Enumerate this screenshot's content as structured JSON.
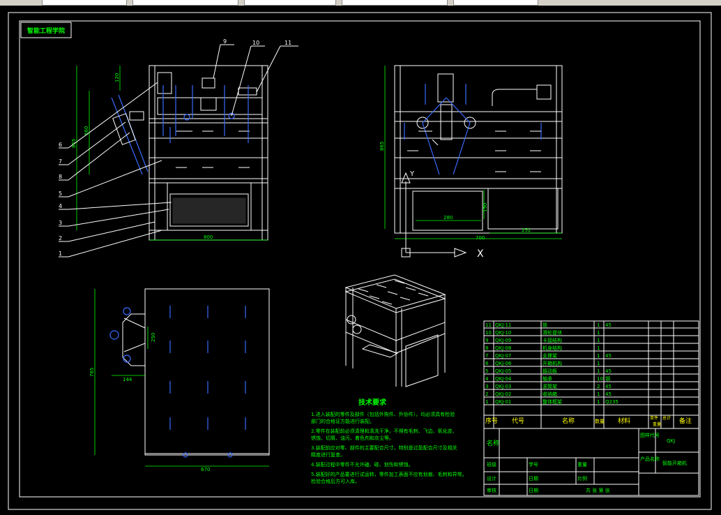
{
  "title_block_label": "智能工程学院",
  "callouts": [
    "9",
    "10",
    "11",
    "6",
    "7",
    "8",
    "5",
    "4",
    "3",
    "2",
    "1"
  ],
  "axis_x": "X",
  "axis_y": "Y",
  "tech_req": {
    "heading": "技术要求",
    "lines": [
      "1.进入装配的零件及部件（包括外购件、外协件），均必须具有检验",
      "  部门的合格证方能进行装配。",
      "2.零件在装配前必须清理和清洗干净，不得有毛刺、飞边、氧化皮、",
      "  锈蚀、切屑、油污、着色剂和灰尘等。",
      "3.装配前应对零、部件的主要配合尺寸，特别是过盈配合尺寸及相关",
      "  精度进行复查。",
      "4.装配过程中零件不允许磕、碰、划伤和锈蚀。",
      "5.装配好的产品要进行试运转，零件加工表面不应有划痕、毛刺和异常。",
      "  检验合格后方可入库。"
    ]
  },
  "bom": {
    "rows": [
      {
        "no": "11",
        "code": "QKJ-11",
        "name": "锁",
        "qty": "1",
        "mat": "45"
      },
      {
        "no": "10",
        "code": "QKJ-10",
        "name": "滑轮提块",
        "qty": "1",
        "mat": ""
      },
      {
        "no": "9",
        "code": "QKJ-09",
        "name": "卡接结构",
        "qty": "1",
        "mat": ""
      },
      {
        "no": "8",
        "code": "QKJ-08",
        "name": "机身结构",
        "qty": "1",
        "mat": ""
      },
      {
        "no": "7",
        "code": "QKJ-07",
        "name": "支撑架",
        "qty": "1",
        "mat": "45"
      },
      {
        "no": "6",
        "code": "QKJ-06",
        "name": "开箱机构",
        "qty": "1",
        "mat": ""
      },
      {
        "no": "5",
        "code": "QKJ-05",
        "name": "振动板",
        "qty": "1",
        "mat": "45"
      },
      {
        "no": "4",
        "code": "QKJ-04",
        "name": "轴承",
        "qty": "10",
        "mat": "钢"
      },
      {
        "no": "3",
        "code": "QKJ-03",
        "name": "滚筒架",
        "qty": "2",
        "mat": "45"
      },
      {
        "no": "2",
        "code": "QKJ-02",
        "name": "收纳箱",
        "qty": "1",
        "mat": "45"
      },
      {
        "no": "1",
        "code": "QKJ-01",
        "name": "整体框架",
        "qty": "1",
        "mat": "Q235"
      }
    ],
    "header": {
      "no": "序号",
      "code": "代号",
      "name": "名称",
      "qty": "数量",
      "mat": "材料",
      "single": "单件",
      "total": "总计",
      "weight": "重量",
      "note": "备注"
    },
    "tb_name_label": "名称",
    "tb_drawing_no": "图样代号",
    "tb_code": "QKJ",
    "tb_product": "产品名称",
    "tb_product_name": "智能开箱机",
    "tb_design": "设计",
    "tb_check": "审核",
    "tb_student": "学号",
    "tb_date": "日期",
    "tb_weight": "重量",
    "tb_scale": "比例",
    "tb_sheets": "共  张  第  张",
    "tb_dept": "班级"
  },
  "dims": {
    "front_w": "800",
    "front_h": "865",
    "front_h2": "660",
    "front_top": "120",
    "side_h": "865",
    "side_w": "700",
    "side_in": "280",
    "side_r": "252",
    "side_low": "150",
    "top_w": "670",
    "top_h": "765",
    "top_l": "144",
    "top_m": "250"
  }
}
